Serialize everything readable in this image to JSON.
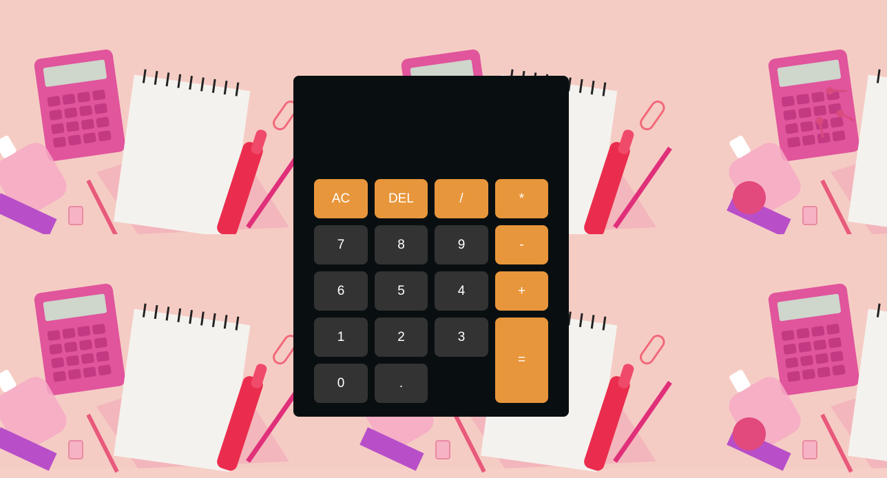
{
  "display": {
    "previous": "",
    "current": ""
  },
  "colors": {
    "operator": "#e8963b",
    "number": "#333333",
    "panel": "#090f11"
  },
  "keys": {
    "ac": "AC",
    "del": "DEL",
    "divide": "/",
    "multiply": "*",
    "seven": "7",
    "eight": "8",
    "nine": "9",
    "minus": "-",
    "six": "6",
    "five": "5",
    "four": "4",
    "plus": "+",
    "one": "1",
    "two": "2",
    "three": "3",
    "equals": "=",
    "zero": "0",
    "dot": "."
  }
}
